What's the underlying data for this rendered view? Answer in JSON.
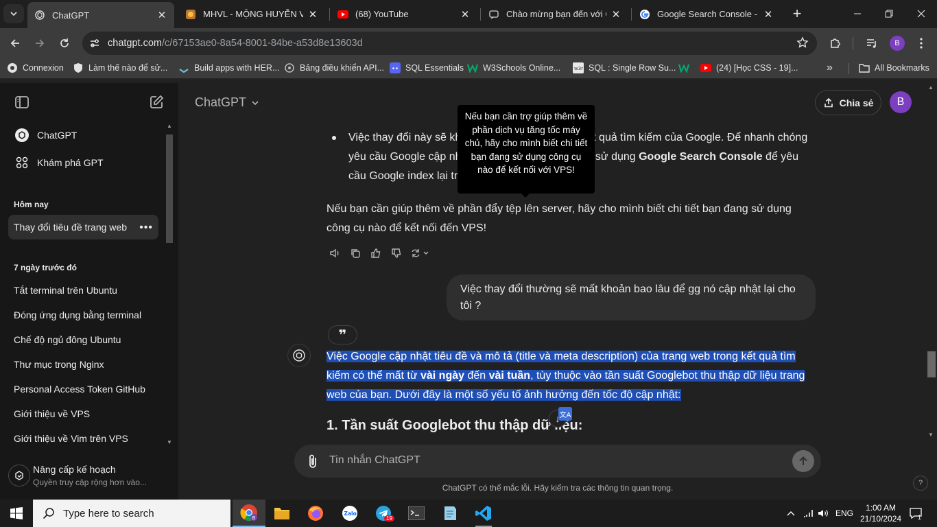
{
  "browser": {
    "tabs": [
      {
        "title": "ChatGPT",
        "active": true
      },
      {
        "title": "MHVL - MỘNG HUYỄN VÕ L",
        "active": false
      },
      {
        "title": "(68) YouTube",
        "active": false
      },
      {
        "title": "Chào mừng bạn đến với Goo",
        "active": false
      },
      {
        "title": "Google Search Console - Tìn",
        "active": false
      }
    ],
    "url_host": "chatgpt.com",
    "url_path": "/c/67153ae0-8a54-8001-84be-a53d8e13603d",
    "profile_letter": "B",
    "bookmarks": [
      {
        "label": "Connexion",
        "icon": "globe-icon"
      },
      {
        "label": "Làm thế nào để sử...",
        "icon": "shield-icon"
      },
      {
        "label": "Build apps with HER...",
        "icon": "heroku-icon"
      },
      {
        "label": "Bảng điều khiển API...",
        "icon": "openai-icon"
      },
      {
        "label": "SQL Essentials",
        "icon": "discord-icon"
      },
      {
        "label": "W3Schools Online...",
        "icon": "w3schools-icon"
      },
      {
        "label": "SQL : Single Row Su...",
        "icon": "w3r-icon"
      },
      {
        "label": "",
        "icon": "w3schools-icon"
      },
      {
        "label": "(24) [Học CSS - 19]...",
        "icon": "youtube-icon"
      }
    ],
    "all_bookmarks": "All Bookmarks"
  },
  "sidebar": {
    "nav": [
      {
        "label": "ChatGPT",
        "icon": "openai-icon"
      },
      {
        "label": "Khám phá GPT",
        "icon": "grid-icon"
      }
    ],
    "today_label": "Hôm nay",
    "today_items": [
      "Thay đổi tiêu đề trang web"
    ],
    "week_label": "7 ngày trước đó",
    "week_items": [
      "Tắt terminal trên Ubuntu",
      "Đóng ứng dụng bằng terminal",
      "Chế độ ngủ đông Ubuntu",
      "Thư mục trong Nginx",
      "Personal Access Token GitHub",
      "Giới thiệu về VPS",
      "Giới thiệu về Vim trên VPS"
    ],
    "upgrade_title": "Nâng cấp kế hoạch",
    "upgrade_sub": "Quyền truy cập rộng hơn vào..."
  },
  "header": {
    "model": "ChatGPT",
    "share": "Chia sẻ",
    "avatar_letter": "B"
  },
  "conversation": {
    "bullet_parts": [
      "Việc thay đổi này sẽ kh",
      "ết quả tìm kiếm của Google. Để nhanh chóng yêu cầu Google cập nh",
      "ể sử dụng ",
      "Google Search Console",
      " để yêu cầu Google index lại trang"
    ],
    "para1": "Nếu bạn cần giúp thêm về phần đẩy tệp lên server, hãy cho mình biết chi tiết bạn đang sử dụng công cụ nào để kết nối đến VPS!",
    "user_message": "Việc thay đổi thường sẽ mất khoản bao lâu để gg nó cập nhật lại cho tôi ?",
    "quote_glyph": "❞",
    "answer_parts": [
      "Việc Google cập nhật tiêu đề và mô tả (title và meta description) của trang web trong kết quả tìm kiếm có thể mất từ ",
      "vài ngày",
      " đến ",
      "vài tuần",
      ", tùy thuộc vào tần suất Googlebot thu thập dữ liệu trang web của bạn. Dưới đây là một số yếu tố ảnh hưởng đến tốc độ cập nhật:"
    ],
    "heading": "1. Tần suất Googlebot thu thập dữ liệu:",
    "tooltip": "Nếu bạn cần trợ giúp thêm về phần dịch vụ tăng tốc máy chủ, hãy cho mình biết chi tiết bạn đang sử dụng công cụ nào để kết nối với VPS!"
  },
  "composer": {
    "placeholder": "Tin nhắn ChatGPT",
    "disclaimer": "ChatGPT có thể mắc lỗi. Hãy kiểm tra các thông tin quan trọng.",
    "help": "?"
  },
  "taskbar": {
    "search_placeholder": "Type here to search",
    "language": "ENG",
    "time": "1:00 AM",
    "date": "21/10/2024",
    "notifications": "1",
    "telegram_badge": "19"
  },
  "colors": {
    "selection": "#1f4fb4",
    "sidebar_bg": "#171717",
    "main_bg": "#212121",
    "avatar": "#7b3fbf"
  }
}
